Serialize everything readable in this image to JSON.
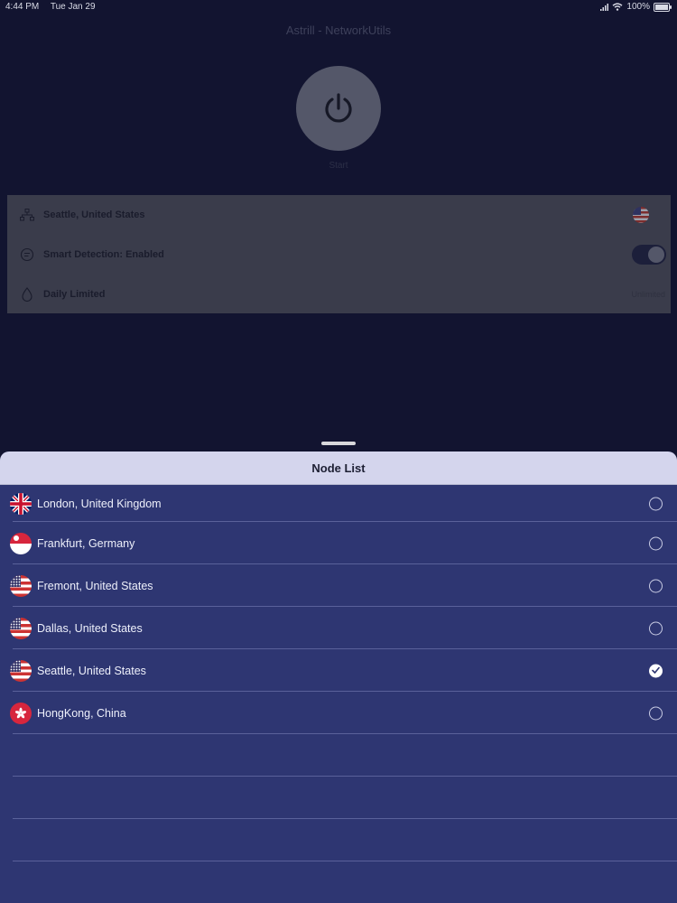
{
  "statusbar": {
    "time": "4:44 PM",
    "date": "Tue Jan 29",
    "battery": "100%"
  },
  "app": {
    "title": "Astrill - NetworkUtils"
  },
  "power": {
    "label": "Start"
  },
  "settings": {
    "location": "Seattle, United States",
    "smart_detection": "Smart Detection: Enabled",
    "data_plan": "Daily Limited",
    "data_plan_value": "Unlimited"
  },
  "sheet": {
    "title": "Node List",
    "nodes": [
      {
        "name": "London, United Kingdom",
        "flag": "uk-flag-icon",
        "selected": false
      },
      {
        "name": "Frankfurt, Germany",
        "flag": "sg-flag-icon",
        "selected": false
      },
      {
        "name": "Fremont, United States",
        "flag": "us-flag-icon",
        "selected": false
      },
      {
        "name": "Dallas, United States",
        "flag": "us-flag-icon",
        "selected": false
      },
      {
        "name": "Seattle, United States",
        "flag": "us-flag-icon",
        "selected": true
      },
      {
        "name": "HongKong, China",
        "flag": "hk-flag-icon",
        "selected": false
      }
    ]
  }
}
